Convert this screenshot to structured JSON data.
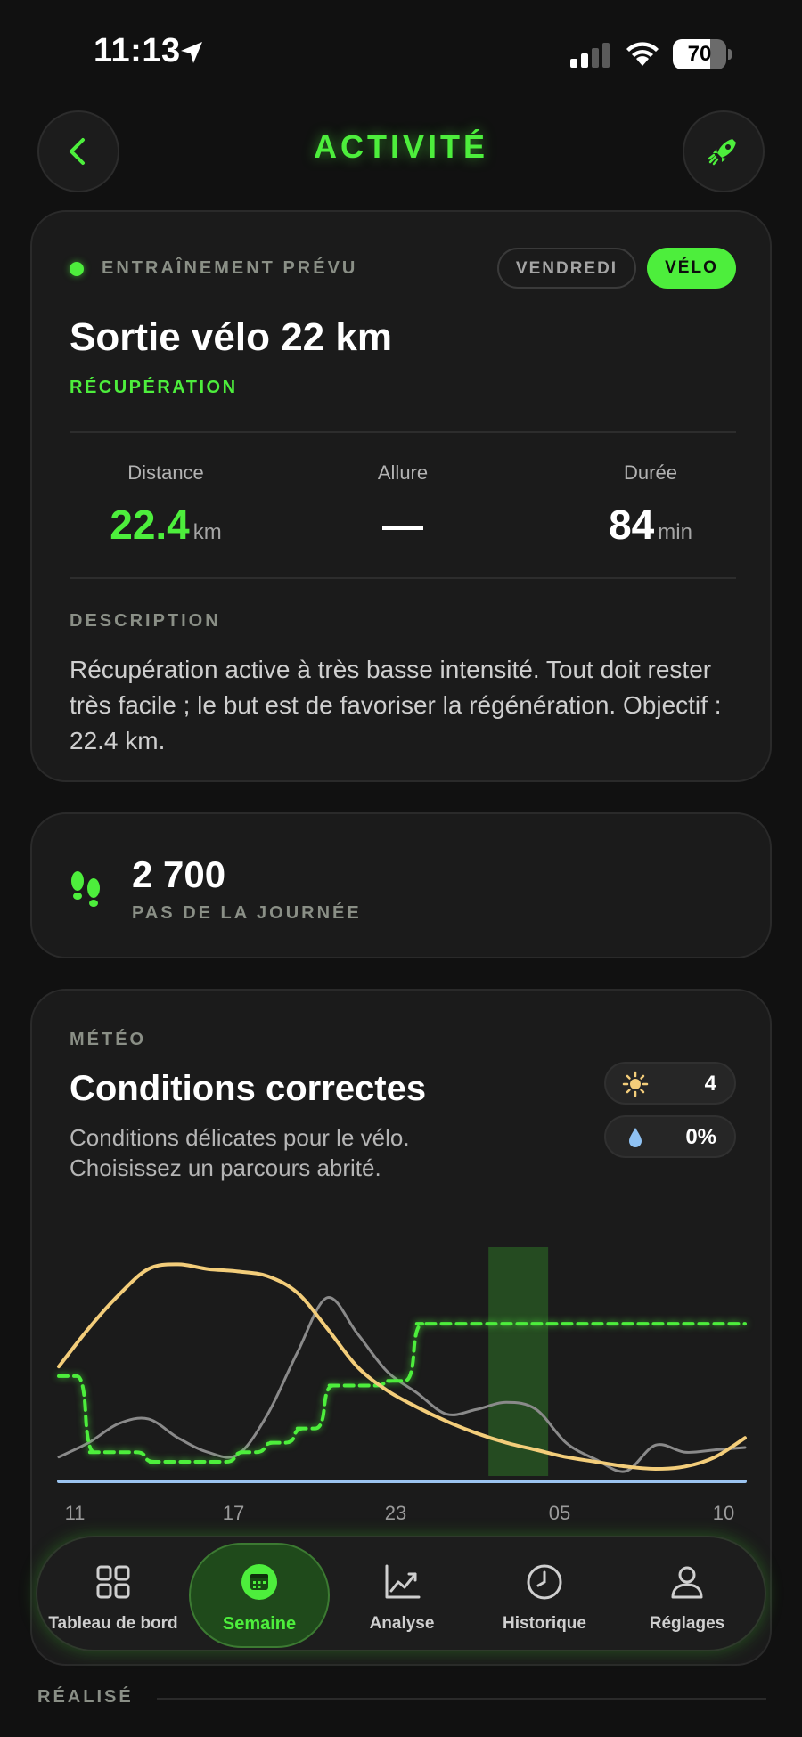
{
  "status_bar": {
    "time": "11:13",
    "battery": "70",
    "battery_level": 0.7
  },
  "header": {
    "title": "ACTIVITÉ"
  },
  "workout": {
    "planned_label": "ENTRAÎNEMENT PRÉVU",
    "day_chip": "VENDREDI",
    "sport_chip": "VÉLO",
    "title": "Sortie vélo 22 km",
    "subtitle": "RÉCUPÉRATION",
    "metrics": [
      {
        "label": "Distance",
        "value": "22.4",
        "unit": "km"
      },
      {
        "label": "Allure",
        "value": "—",
        "unit": ""
      },
      {
        "label": "Durée",
        "value": "84",
        "unit": "min"
      }
    ],
    "description_label": "DESCRIPTION",
    "description": "Récupération active à très basse intensité. Tout doit rester très facile ; le but est de favoriser la régénération. Objectif : 22.4 km."
  },
  "steps": {
    "value": "2 700",
    "label": "PAS DE LA JOURNÉE"
  },
  "weather": {
    "section_label": "MÉTÉO",
    "title": "Conditions correctes",
    "description": "Conditions délicates pour le vélo. Choisissez un parcours abrité.",
    "uv": "4",
    "rain": "0%",
    "colors": {
      "temperature": "#f3cd7a",
      "wind": "#8a8a8a",
      "effort": "#4dee3c",
      "baseline": "#9cc4f0",
      "highlight": "#2a5c24"
    }
  },
  "chart_data": {
    "type": "line",
    "x_tick_labels": [
      "11",
      "17",
      "23",
      "05",
      "10"
    ],
    "x": [
      11,
      12,
      13,
      14,
      15,
      16,
      17,
      18,
      19,
      20,
      21,
      22,
      23,
      24,
      25,
      26,
      27,
      28,
      29,
      30,
      31,
      32,
      33,
      34
    ],
    "highlight_range": [
      26,
      28
    ],
    "series": [
      {
        "style": "solid-yellow",
        "values": [
          0.46,
          0.62,
          0.76,
          0.87,
          0.89,
          0.87,
          0.86,
          0.84,
          0.77,
          0.62,
          0.46,
          0.36,
          0.29,
          0.23,
          0.18,
          0.14,
          0.11,
          0.08,
          0.06,
          0.04,
          0.03,
          0.04,
          0.08,
          0.16
        ]
      },
      {
        "style": "solid-gray",
        "values": [
          0.08,
          0.14,
          0.22,
          0.24,
          0.16,
          0.1,
          0.09,
          0.26,
          0.52,
          0.75,
          0.6,
          0.44,
          0.35,
          0.26,
          0.28,
          0.31,
          0.28,
          0.14,
          0.07,
          0.02,
          0.13,
          0.1,
          0.11,
          0.12
        ]
      },
      {
        "style": "dashed-green",
        "values": [
          0.42,
          0.1,
          0.1,
          0.06,
          0.06,
          0.06,
          0.1,
          0.14,
          0.2,
          0.38,
          0.38,
          0.4,
          0.64,
          0.64,
          0.64,
          0.64,
          0.64,
          0.64,
          0.64,
          0.64,
          0.64,
          0.64,
          0.64,
          0.64
        ]
      },
      {
        "style": "flat-blue",
        "values": [
          0,
          0,
          0,
          0,
          0,
          0,
          0,
          0,
          0,
          0,
          0,
          0,
          0,
          0,
          0,
          0,
          0,
          0,
          0,
          0,
          0,
          0,
          0,
          0
        ]
      }
    ]
  },
  "nav": {
    "items": [
      {
        "label": "Tableau de bord"
      },
      {
        "label": "Semaine"
      },
      {
        "label": "Analyse"
      },
      {
        "label": "Historique"
      },
      {
        "label": "Réglages"
      }
    ]
  },
  "realise_label": "RÉALISÉ"
}
